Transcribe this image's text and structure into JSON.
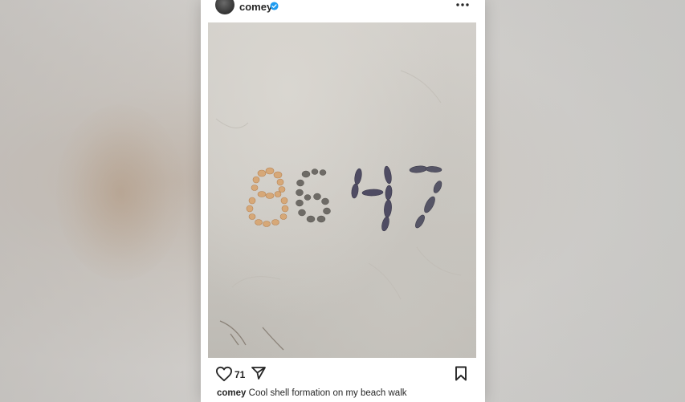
{
  "post": {
    "username": "comey",
    "verified": true,
    "likes": "71",
    "caption_user": "comey",
    "caption_text": "Cool shell formation on my beach walk"
  },
  "icons": {
    "more": "more-options-icon",
    "like": "heart-icon",
    "share": "send-icon",
    "save": "bookmark-icon",
    "verified": "verified-badge-icon"
  },
  "colors": {
    "text": "#262626",
    "verified": "#1d9bf0"
  }
}
